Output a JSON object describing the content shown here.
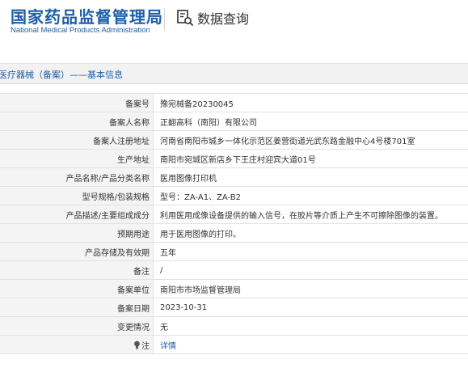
{
  "header": {
    "logo_cn": "国家药品监督管理局",
    "logo_en": "National Medical Products Administration",
    "query_label": "数据查询"
  },
  "section": {
    "title": "医疗器械（备案）——基本信息"
  },
  "rows": [
    {
      "label": "备案号",
      "value": "豫宛械备20230045"
    },
    {
      "label": "备案人名称",
      "value": "正翻高科（南阳）有限公司"
    },
    {
      "label": "备案人注册地址",
      "value": "河南省南阳市城乡一体化示范区姜营街道光武东路金融中心4号楼701室"
    },
    {
      "label": "生产地址",
      "value": "南阳市宛城区新店乡下王庄村迎宾大道01号"
    },
    {
      "label": "产品名称/产品分类名称",
      "value": "医用图像打印机"
    },
    {
      "label": "型号规格/包装规格",
      "value": "型号：ZA-A1、ZA-B2"
    },
    {
      "label": "产品描述/主要组成成分",
      "value": "利用医用成像设备提供的输入信号，在胶片等介质上产生不可擦除图像的装置。"
    },
    {
      "label": "预期用途",
      "value": "用于医用图像的打印。"
    },
    {
      "label": "产品存储及有效期",
      "value": "五年"
    },
    {
      "label": "备注",
      "value": "/"
    },
    {
      "label": "备案单位",
      "value": "南阳市市场监督管理局"
    },
    {
      "label": "备案日期",
      "value": "2023-10-31"
    },
    {
      "label": "变更情况",
      "value": "无"
    },
    {
      "label": "注",
      "value": "详情",
      "icon": "lightbulb-icon"
    }
  ],
  "colors": {
    "brand_blue": "#1f5ea8",
    "label_bg": "#f4f4f4",
    "border": "#e2e2e2"
  }
}
